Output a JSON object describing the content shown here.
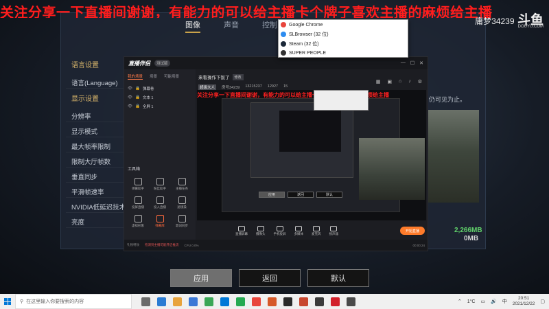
{
  "overlay": {
    "caption": "关注分享一下直播间谢谢，有能力的可以给主播卡个牌子喜欢主播的麻烦给主播",
    "watermark_name": "庸梦34239",
    "watermark_logo": "斗鱼",
    "watermark_url": "DOUYU.COM"
  },
  "game_settings": {
    "tabs": [
      "图像",
      "声音",
      "控制"
    ],
    "active_tab": "图像",
    "sections": [
      {
        "title": "语言设置",
        "rows": [
          "语言(Language)"
        ]
      },
      {
        "title": "显示设置",
        "rows": [
          "分辨率",
          "显示模式",
          "最大帧率限制",
          "限制大厅帧数",
          "垂直同步",
          "平滑帧速率",
          "NVIDIA低延迟技术",
          "亮度"
        ]
      }
    ],
    "hint_text": "仍可见为止。",
    "memory_values": [
      "2,266MB",
      "0MB"
    ],
    "buttons": {
      "apply": "应用",
      "back": "返回",
      "default": "默认"
    }
  },
  "jumplist": {
    "items": [
      {
        "label": "Google Chrome",
        "icon": "chrome-icon",
        "color": "#e8453c"
      },
      {
        "label": "SLBrowser (32 位)",
        "icon": "browser-icon",
        "color": "#2d8cf0"
      },
      {
        "label": "Steam (32 位)",
        "icon": "steam-icon",
        "color": "#1b2838"
      },
      {
        "label": "SUPER PEOPLE",
        "icon": "game-icon",
        "color": "#333333"
      }
    ]
  },
  "streamer_app": {
    "logo": "直播伴侣",
    "version": "测试版",
    "side_tabs": [
      "我的场景",
      "场景",
      "可能场景"
    ],
    "scenes": [
      "弹幕卷",
      "文本 1",
      "全屏 1"
    ],
    "tools_title": "工具箱",
    "tools": [
      {
        "label": "弹幕助手",
        "hot": false
      },
      {
        "label": "粉丝助手",
        "hot": false
      },
      {
        "label": "主播任务",
        "hot": false
      },
      {
        "label": "投屏直播",
        "hot": false
      },
      {
        "label": "投入直播",
        "hot": false
      },
      {
        "label": "滤镜操",
        "hot": false
      },
      {
        "label": "虚拟形象",
        "hot": false
      },
      {
        "label": "弹幕库",
        "hot": true
      },
      {
        "label": "歌词同步",
        "hot": false
      }
    ],
    "room_title": "来看操作下饭了",
    "modify_label": "修改",
    "room_stats": {
      "level": "超级大人",
      "room": "房号34239",
      "fans": "13215237",
      "viewers": "12927",
      "likes": "15"
    },
    "preview_caption": "关注分享一下直播间谢谢，有能力的可以给主播卡个牌子喜欢主播的麻烦给主播",
    "preview_buttons": [
      "应用",
      "返回",
      "默认"
    ],
    "controls": [
      "直播屏幕",
      "摄像头",
      "手机投屏",
      "多媒体",
      "麦克风",
      "扬声器"
    ],
    "live_button": "开始直播",
    "status": {
      "left": "礼物特效",
      "warn": "检测到主播可能开启推流",
      "mid": "CPU 0.0%",
      "right": "00:00:24"
    }
  },
  "taskbar": {
    "search_placeholder": "在这里输入你要搜索的内容",
    "apps": [
      "#6b6b6b",
      "#2b7cd3",
      "#e8a33d",
      "#3b78d6",
      "#3aa757",
      "#0078d7",
      "#25a952",
      "#e8453c",
      "#d65a2a",
      "#2a2a2a",
      "#c8472f",
      "#3b3b3b",
      "#d2202b",
      "#4a4a4a"
    ],
    "temperature": "1°C",
    "ime": "中",
    "time": "20:51",
    "date": "2021/12/22"
  }
}
